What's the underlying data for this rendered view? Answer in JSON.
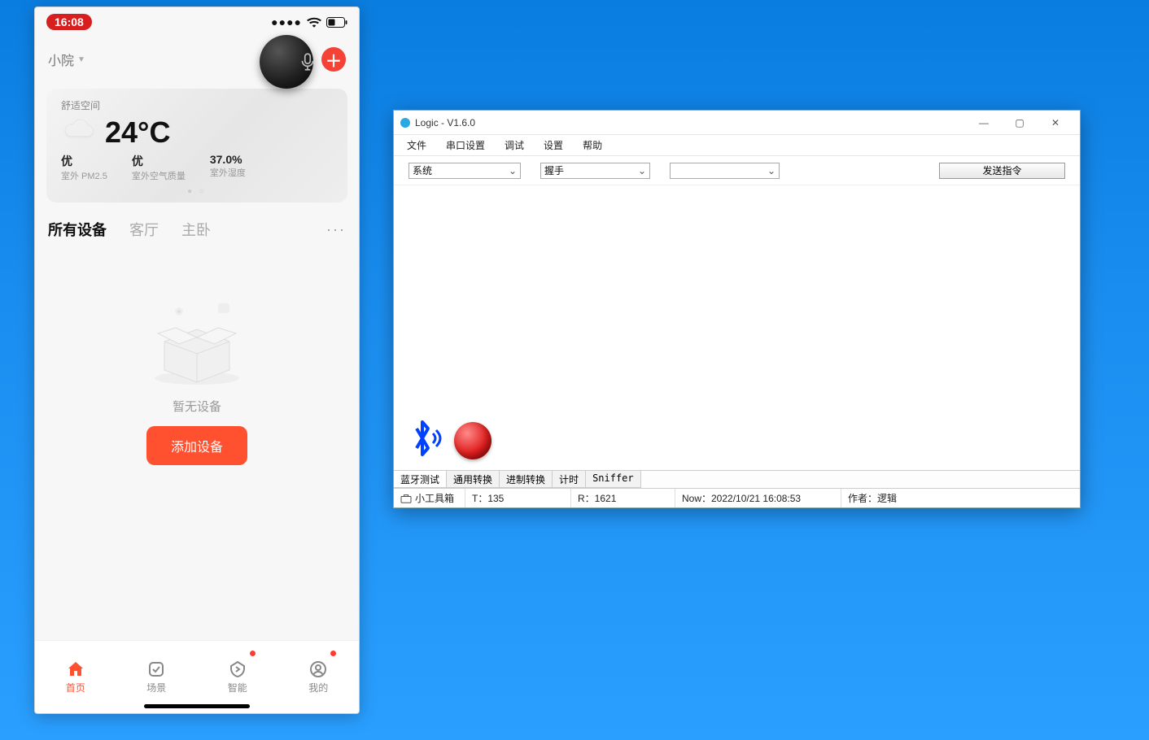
{
  "phone": {
    "status": {
      "time": "16:08"
    },
    "header": {
      "home_name": "小院"
    },
    "weather": {
      "label": "舒适空间",
      "temp": "24°C",
      "cols": [
        {
          "value": "优",
          "sub": "室外 PM2.5"
        },
        {
          "value": "优",
          "sub": "室外空气质量"
        },
        {
          "value": "37.0%",
          "sub": "室外湿度"
        }
      ]
    },
    "tabs": {
      "items": [
        "所有设备",
        "客厅",
        "主卧"
      ],
      "active": 0
    },
    "empty": {
      "text": "暂无设备",
      "button": "添加设备"
    },
    "nav": {
      "items": [
        {
          "label": "首页",
          "active": true,
          "dot": false,
          "icon": "home"
        },
        {
          "label": "场景",
          "active": false,
          "dot": false,
          "icon": "scene"
        },
        {
          "label": "智能",
          "active": false,
          "dot": true,
          "icon": "smart"
        },
        {
          "label": "我的",
          "active": false,
          "dot": true,
          "icon": "mine"
        }
      ]
    }
  },
  "win": {
    "title": "Logic - V1.6.0",
    "menus": [
      "文件",
      "串口设置",
      "调试",
      "设置",
      "帮助"
    ],
    "combo1": "系统",
    "combo2": "握手",
    "combo3": "",
    "send_label": "发送指令",
    "bottom_tabs": [
      "蓝牙测试",
      "通用转换",
      "进制转换",
      "计时",
      "Sniffer"
    ],
    "bottom_active": 0,
    "status": {
      "toolbox": "小工具箱",
      "tx": "T：135",
      "rx": "R：1621",
      "now": "Now：2022/10/21 16:08:53",
      "author": "作者：逻辑"
    }
  }
}
